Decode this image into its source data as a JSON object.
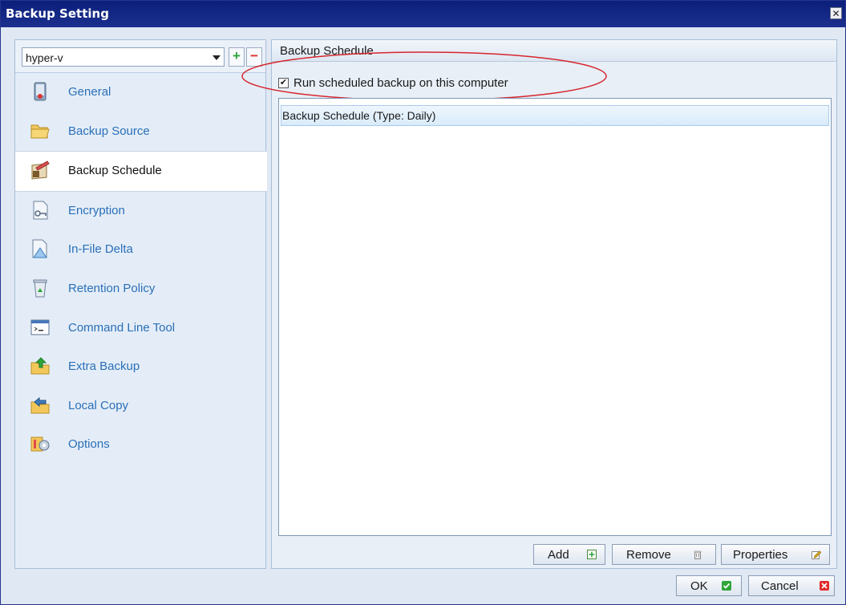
{
  "window": {
    "title": "Backup Setting",
    "close_glyph": "✕"
  },
  "sidebar": {
    "backupset": {
      "value": "hyper-v"
    },
    "add_symbol": "+",
    "remove_symbol": "−",
    "items": [
      {
        "label": "General",
        "icon": "general-icon"
      },
      {
        "label": "Backup Source",
        "icon": "folder-icon"
      },
      {
        "label": "Backup Schedule",
        "icon": "schedule-icon",
        "selected": true
      },
      {
        "label": "Encryption",
        "icon": "encryption-key-icon"
      },
      {
        "label": "In-File Delta",
        "icon": "delta-icon"
      },
      {
        "label": "Retention Policy",
        "icon": "recycle-bin-icon"
      },
      {
        "label": "Command Line Tool",
        "icon": "command-line-icon"
      },
      {
        "label": "Extra Backup",
        "icon": "extra-backup-icon"
      },
      {
        "label": "Local Copy",
        "icon": "local-copy-icon"
      },
      {
        "label": "Options",
        "icon": "options-icon"
      }
    ]
  },
  "main": {
    "header": "Backup Schedule",
    "run_scheduled": {
      "label": "Run scheduled backup on this computer",
      "checked": true,
      "check_glyph": "✔"
    },
    "schedules": [
      "Backup Schedule (Type: Daily)"
    ],
    "buttons": {
      "add": "Add",
      "remove": "Remove",
      "properties": "Properties"
    }
  },
  "footer": {
    "ok": "OK",
    "cancel": "Cancel"
  },
  "colors": {
    "title_bar": "#0a1f7a",
    "nav_text": "#2a6fb8",
    "annotation": "#d7262e",
    "ok_green": "#2fa53a",
    "cancel_red": "#e12a2a"
  }
}
